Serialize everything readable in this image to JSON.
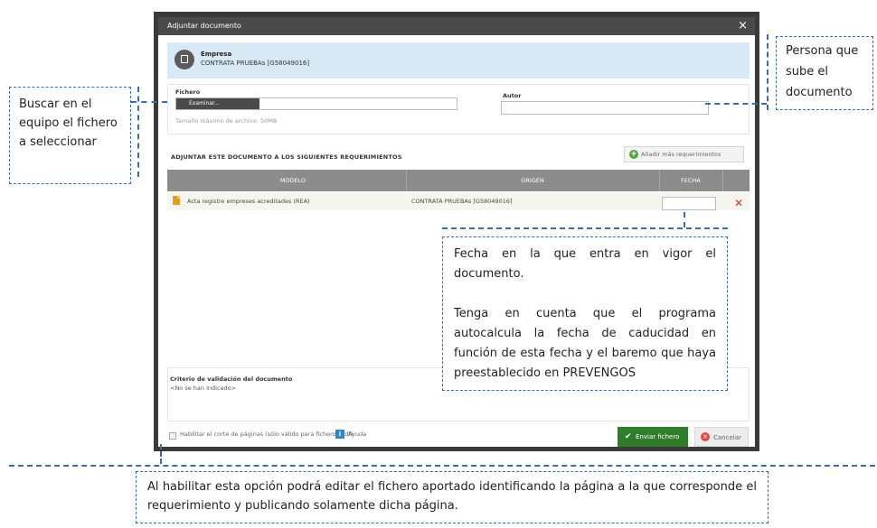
{
  "dialog": {
    "title": "Adjuntar documento",
    "close": "×",
    "company": {
      "title": "Empresa",
      "name": "CONTRATA PRUEBAs [G58049016]"
    },
    "file": {
      "label": "Fichero",
      "browse": "Examinar...",
      "max_size": "Tamaño máximo de archivo: 50MB"
    },
    "author": {
      "label": "Autor",
      "value": ""
    },
    "requirements": {
      "title": "ADJUNTAR ESTE DOCUMENTO A LOS SIGUIENTES REQUERIMIENTOS",
      "add_button": "Añadir más requerimientos",
      "columns": [
        "MODELO",
        "ORIGEN",
        "FECHA"
      ],
      "rows": [
        {
          "model": "Acta registre empreses acreditades (REA)",
          "origin": "CONTRATA PRUEBAs [G58049016]",
          "date": ""
        }
      ]
    },
    "criteria": {
      "label": "Criterio de validación del documento",
      "value": "<No se han indicado>"
    },
    "footer": {
      "page_cut": "Habilitar el corte de páginas (sólo válido para ficheros pdf)",
      "help": "Ayuda",
      "send": "Enviar fichero",
      "cancel": "Cancelar"
    }
  },
  "callouts": {
    "search": "Buscar en el equipo el fichero a seleccionar",
    "author": "Persona que sube el documento",
    "date_p1": "Fecha en la que entra en vigor el documento.",
    "date_p2": "Tenga en cuenta que el programa autocalcula la fecha de caducidad en función de esta fecha y el baremo que haya preestablecido en PREVENGOS",
    "page_cut": "Al habilitar esta opción podrá editar el fichero aportado identificando la página a la que corresponde el requerimiento y publicando solamente dicha página."
  },
  "colors": {
    "titlebar": "#4a4a4a",
    "company_bg": "#d8e9f6",
    "send": "#2f7d2a",
    "delete": "#d7352a",
    "callout_border": "#3a6db0"
  }
}
